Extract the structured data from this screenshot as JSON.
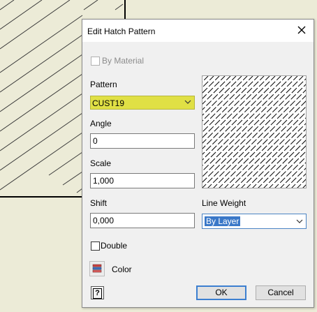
{
  "dialog": {
    "title": "Edit Hatch Pattern",
    "by_material_label": "By Material",
    "pattern_label": "Pattern",
    "pattern_value": "CUST19",
    "angle_label": "Angle",
    "angle_value": "0",
    "scale_label": "Scale",
    "scale_value": "1,000",
    "shift_label": "Shift",
    "shift_value": "0,000",
    "line_weight_label": "Line Weight",
    "line_weight_value": "By Layer",
    "double_label": "Double",
    "color_label": "Color",
    "help_label": "?",
    "ok_label": "OK",
    "cancel_label": "Cancel"
  },
  "colors": {
    "canvas_background": "#ecebd7",
    "pattern_highlight": "#e0e045",
    "selection_blue": "#3a78c8",
    "default_button_border": "#3c7fd0"
  },
  "icons": {
    "close": "close-icon",
    "dropdown": "chevron-down-icon",
    "color": "color-layers-icon",
    "help": "help-icon"
  }
}
